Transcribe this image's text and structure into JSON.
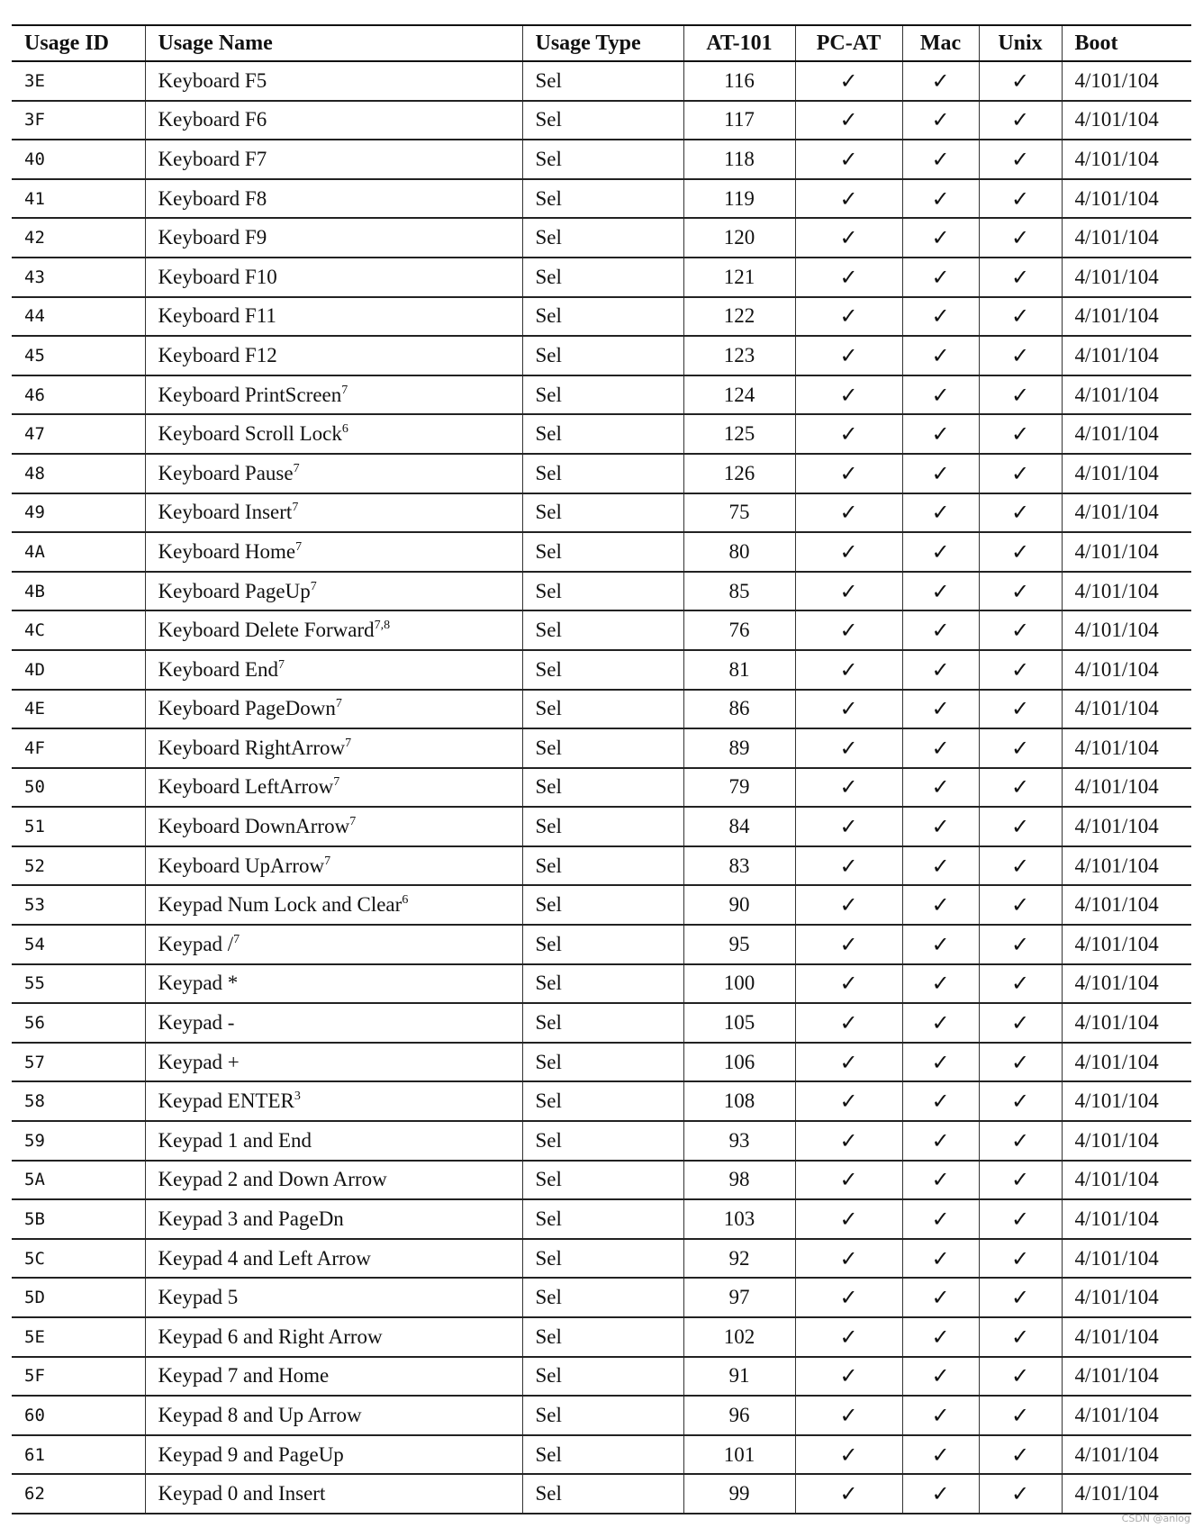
{
  "columns": [
    "Usage ID",
    "Usage Name",
    "Usage Type",
    "AT-101",
    "PC-AT",
    "Mac",
    "Unix",
    "Boot"
  ],
  "check_icon": "checkmark-icon",
  "check_glyph": "✓",
  "rows": [
    {
      "id": "3E",
      "name": "Keyboard F5",
      "sup": "",
      "type": "Sel",
      "at101": "116",
      "boot": "4/101/104"
    },
    {
      "id": "3F",
      "name": "Keyboard F6",
      "sup": "",
      "type": "Sel",
      "at101": "117",
      "boot": "4/101/104"
    },
    {
      "id": "40",
      "name": "Keyboard F7",
      "sup": "",
      "type": "Sel",
      "at101": "118",
      "boot": "4/101/104"
    },
    {
      "id": "41",
      "name": "Keyboard F8",
      "sup": "",
      "type": "Sel",
      "at101": "119",
      "boot": "4/101/104"
    },
    {
      "id": "42",
      "name": "Keyboard F9",
      "sup": "",
      "type": "Sel",
      "at101": "120",
      "boot": "4/101/104"
    },
    {
      "id": "43",
      "name": "Keyboard F10",
      "sup": "",
      "type": "Sel",
      "at101": "121",
      "boot": "4/101/104"
    },
    {
      "id": "44",
      "name": "Keyboard F11",
      "sup": "",
      "type": "Sel",
      "at101": "122",
      "boot": "4/101/104"
    },
    {
      "id": "45",
      "name": "Keyboard F12",
      "sup": "",
      "type": "Sel",
      "at101": "123",
      "boot": "4/101/104"
    },
    {
      "id": "46",
      "name": "Keyboard PrintScreen",
      "sup": "7",
      "type": "Sel",
      "at101": "124",
      "boot": "4/101/104"
    },
    {
      "id": "47",
      "name": "Keyboard Scroll Lock",
      "sup": "6",
      "type": "Sel",
      "at101": "125",
      "boot": "4/101/104"
    },
    {
      "id": "48",
      "name": "Keyboard Pause",
      "sup": "7",
      "type": "Sel",
      "at101": "126",
      "boot": "4/101/104"
    },
    {
      "id": "49",
      "name": "Keyboard Insert",
      "sup": "7",
      "type": "Sel",
      "at101": "75",
      "boot": "4/101/104"
    },
    {
      "id": "4A",
      "name": "Keyboard Home",
      "sup": "7",
      "type": "Sel",
      "at101": "80",
      "boot": "4/101/104"
    },
    {
      "id": "4B",
      "name": "Keyboard PageUp",
      "sup": "7",
      "type": "Sel",
      "at101": "85",
      "boot": "4/101/104"
    },
    {
      "id": "4C",
      "name": "Keyboard Delete Forward",
      "sup": "7,8",
      "type": "Sel",
      "at101": "76",
      "boot": "4/101/104"
    },
    {
      "id": "4D",
      "name": "Keyboard End",
      "sup": "7",
      "type": "Sel",
      "at101": "81",
      "boot": "4/101/104"
    },
    {
      "id": "4E",
      "name": "Keyboard PageDown",
      "sup": "7",
      "type": "Sel",
      "at101": "86",
      "boot": "4/101/104"
    },
    {
      "id": "4F",
      "name": "Keyboard RightArrow",
      "sup": "7",
      "type": "Sel",
      "at101": "89",
      "boot": "4/101/104"
    },
    {
      "id": "50",
      "name": "Keyboard LeftArrow",
      "sup": "7",
      "type": "Sel",
      "at101": "79",
      "boot": "4/101/104"
    },
    {
      "id": "51",
      "name": "Keyboard DownArrow",
      "sup": "7",
      "type": "Sel",
      "at101": "84",
      "boot": "4/101/104"
    },
    {
      "id": "52",
      "name": "Keyboard UpArrow",
      "sup": "7",
      "type": "Sel",
      "at101": "83",
      "boot": "4/101/104"
    },
    {
      "id": "53",
      "name": "Keypad Num Lock and Clear",
      "sup": "6",
      "type": "Sel",
      "at101": "90",
      "boot": "4/101/104"
    },
    {
      "id": "54",
      "name": "Keypad /",
      "sup": "7",
      "type": "Sel",
      "at101": "95",
      "boot": "4/101/104"
    },
    {
      "id": "55",
      "name": "Keypad *",
      "sup": "",
      "type": "Sel",
      "at101": "100",
      "boot": "4/101/104"
    },
    {
      "id": "56",
      "name": "Keypad -",
      "sup": "",
      "type": "Sel",
      "at101": "105",
      "boot": "4/101/104"
    },
    {
      "id": "57",
      "name": "Keypad +",
      "sup": "",
      "type": "Sel",
      "at101": "106",
      "boot": "4/101/104"
    },
    {
      "id": "58",
      "name": "Keypad ENTER",
      "sup": "3",
      "type": "Sel",
      "at101": "108",
      "boot": "4/101/104"
    },
    {
      "id": "59",
      "name": "Keypad 1 and End",
      "sup": "",
      "type": "Sel",
      "at101": "93",
      "boot": "4/101/104"
    },
    {
      "id": "5A",
      "name": "Keypad 2 and Down Arrow",
      "sup": "",
      "type": "Sel",
      "at101": "98",
      "boot": "4/101/104"
    },
    {
      "id": "5B",
      "name": "Keypad 3 and PageDn",
      "sup": "",
      "type": "Sel",
      "at101": "103",
      "boot": "4/101/104"
    },
    {
      "id": "5C",
      "name": "Keypad 4 and Left Arrow",
      "sup": "",
      "type": "Sel",
      "at101": "92",
      "boot": "4/101/104"
    },
    {
      "id": "5D",
      "name": "Keypad 5",
      "sup": "",
      "type": "Sel",
      "at101": "97",
      "boot": "4/101/104"
    },
    {
      "id": "5E",
      "name": "Keypad 6 and Right Arrow",
      "sup": "",
      "type": "Sel",
      "at101": "102",
      "boot": "4/101/104"
    },
    {
      "id": "5F",
      "name": "Keypad 7 and Home",
      "sup": "",
      "type": "Sel",
      "at101": "91",
      "boot": "4/101/104"
    },
    {
      "id": "60",
      "name": "Keypad 8 and Up Arrow",
      "sup": "",
      "type": "Sel",
      "at101": "96",
      "boot": "4/101/104"
    },
    {
      "id": "61",
      "name": "Keypad 9 and PageUp",
      "sup": "",
      "type": "Sel",
      "at101": "101",
      "boot": "4/101/104"
    },
    {
      "id": "62",
      "name": "Keypad 0 and Insert",
      "sup": "",
      "type": "Sel",
      "at101": "99",
      "boot": "4/101/104"
    }
  ],
  "watermark": "CSDN @anlog"
}
